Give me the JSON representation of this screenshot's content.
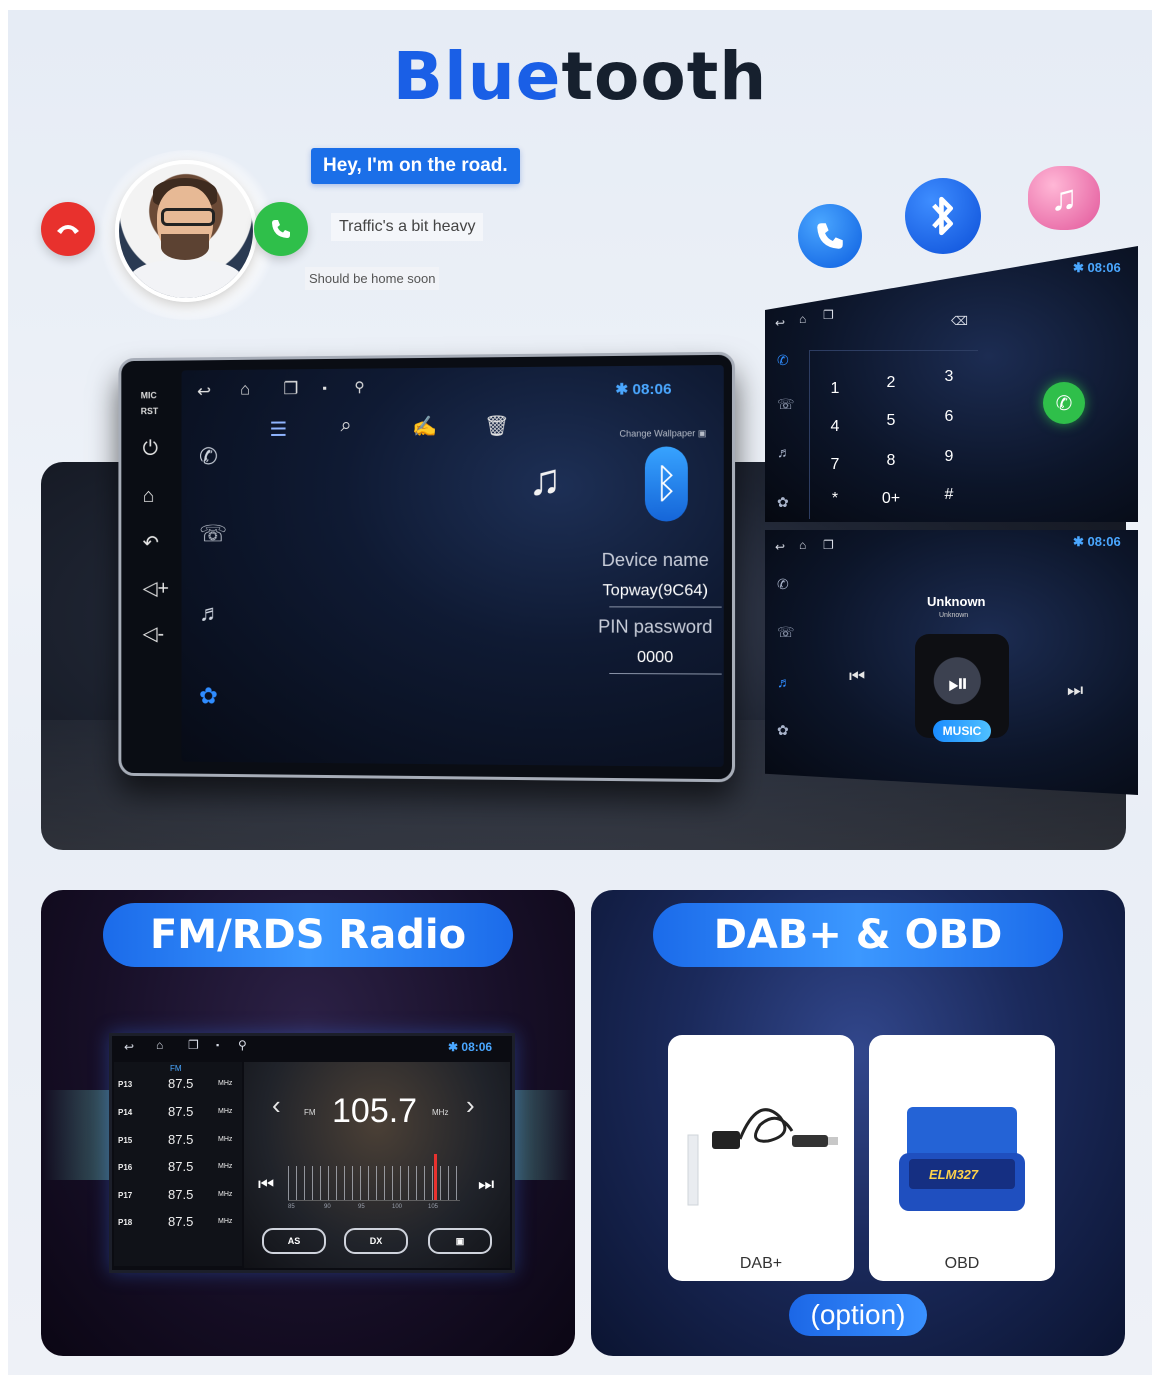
{
  "title": {
    "part1": "Blue",
    "part2": "tooth"
  },
  "call": {
    "bubble_1": "Hey, I'm on the road.",
    "bubble_2": "Traffic's a bit heavy",
    "bubble_3": "Should be home soon"
  },
  "head_unit": {
    "side_labels": [
      "MIC",
      "RST"
    ],
    "time": "08:06",
    "change_wallpaper": "Change Wallpaper",
    "device_name_label": "Device name",
    "device_name_value": "Topway(9C64)",
    "pin_label": "PIN password",
    "pin_value": "0000"
  },
  "dialpad_panel": {
    "time": "08:06",
    "keys": [
      "1",
      "2",
      "3",
      "4",
      "5",
      "6",
      "7",
      "8",
      "9",
      "*",
      "0+",
      "#"
    ]
  },
  "music_panel": {
    "time": "08:06",
    "track_title": "Unknown",
    "track_artist": "Unknown",
    "music_tag": "MUSIC"
  },
  "fm_card": {
    "pill": "FM/RDS Radio",
    "time": "08:06",
    "band": "FM",
    "presets": [
      {
        "p": "P13",
        "f": "87.5",
        "m": "MHz"
      },
      {
        "p": "P14",
        "f": "87.5",
        "m": "MHz"
      },
      {
        "p": "P15",
        "f": "87.5",
        "m": "MHz"
      },
      {
        "p": "P16",
        "f": "87.5",
        "m": "MHz"
      },
      {
        "p": "P17",
        "f": "87.5",
        "m": "MHz"
      },
      {
        "p": "P18",
        "f": "87.5",
        "m": "MHz"
      }
    ],
    "frequency": "105.7",
    "freq_band": "FM",
    "freq_unit": "MHz",
    "dial_ticks": [
      "85",
      "90",
      "95",
      "100",
      "105"
    ],
    "btn_as": "AS",
    "btn_dx": "DX"
  },
  "dab_card": {
    "pill": "DAB+ & OBD",
    "product_1": "DAB+",
    "product_2": "OBD",
    "obd_brand": "ELM327",
    "option": "(option)"
  },
  "colors": {
    "accent_blue": "#1a5fe6",
    "call_red": "#e8312d",
    "call_green": "#2fbf4a"
  }
}
